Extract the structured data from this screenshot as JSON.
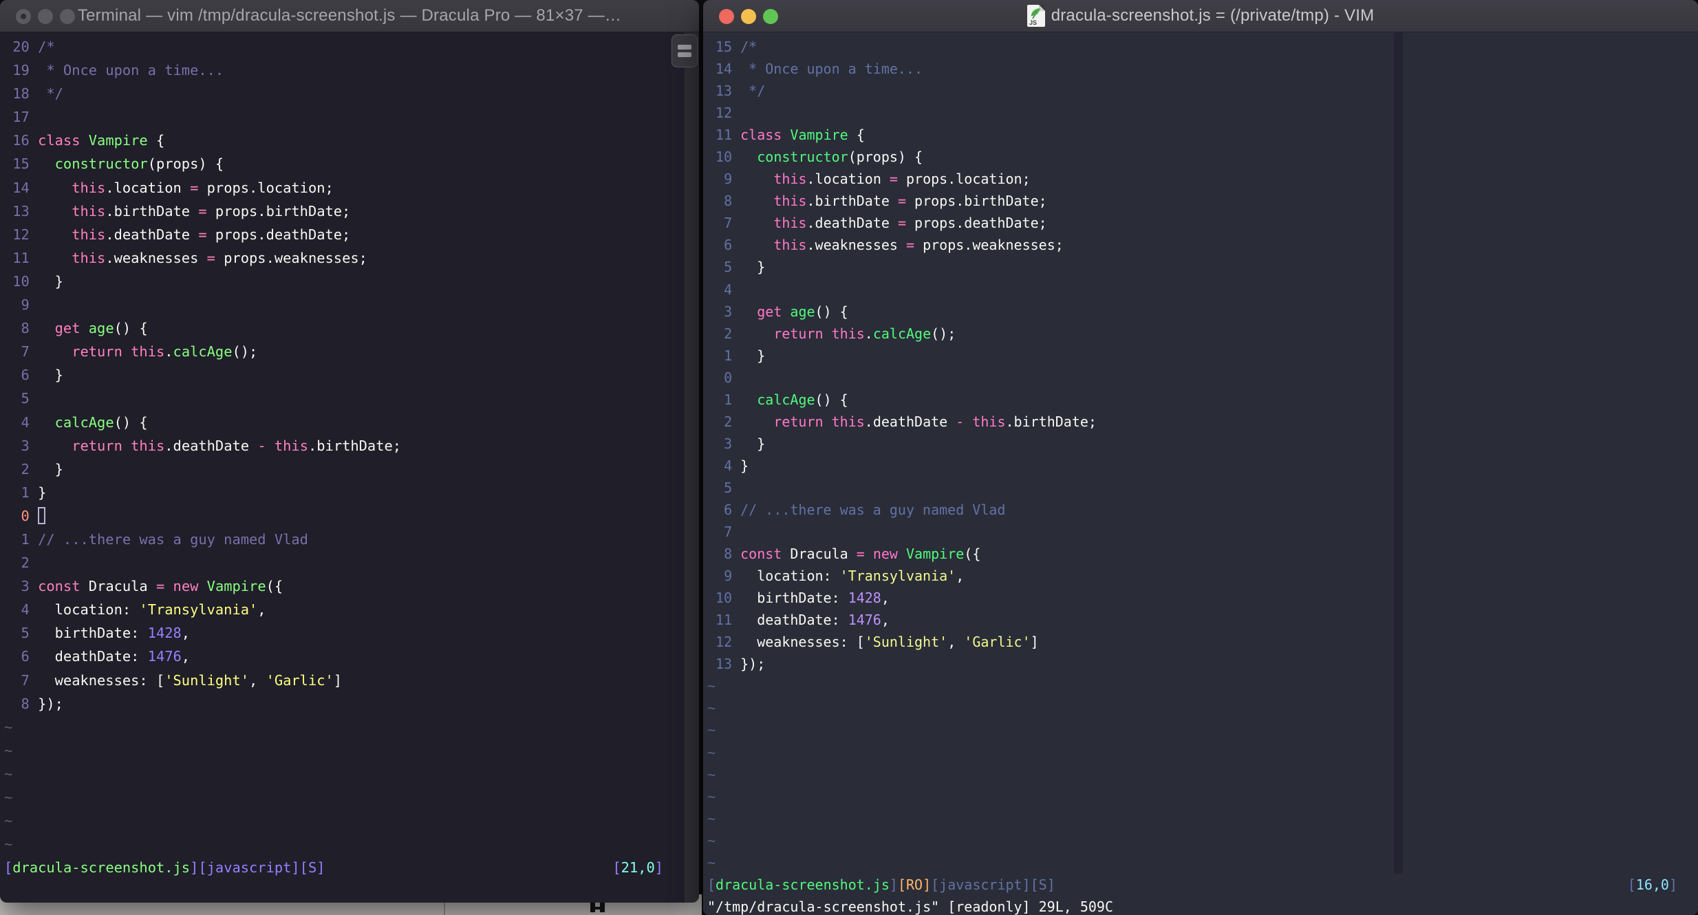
{
  "desktop": {
    "note_fragment": true
  },
  "left_window": {
    "titlebar": {
      "title": "Terminal — vim /tmp/dracula-screenshot.js — Dracula Pro — 81×37 —…"
    },
    "palette": {
      "bg": "#1F1E29",
      "f": "#F8F8F2",
      "c": "#7970A9",
      "p": "#FF80BF",
      "g": "#8AFF80",
      "y": "#FFFF80",
      "u": "#9580FF",
      "n": "#80FFEA",
      "o": "#FF9580",
      "ln": "#7970A9",
      "cursor_ln": "#FF9580",
      "tilde": "#5F5C6E",
      "cursor_outline": "#B9B3D8"
    },
    "tilde_char": "~",
    "tilde_count": 6,
    "lines": [
      {
        "num": "20",
        "tokens": [
          [
            "c",
            "/*"
          ]
        ]
      },
      {
        "num": "19",
        "tokens": [
          [
            "c",
            " * Once upon a time..."
          ]
        ]
      },
      {
        "num": "18",
        "tokens": [
          [
            "c",
            " */"
          ]
        ]
      },
      {
        "num": "17",
        "tokens": []
      },
      {
        "num": "16",
        "tokens": [
          [
            "p",
            "class"
          ],
          [
            "f",
            " "
          ],
          [
            "g",
            "Vampire"
          ],
          [
            "f",
            " {"
          ]
        ]
      },
      {
        "num": "15",
        "tokens": [
          [
            "f",
            "  "
          ],
          [
            "g",
            "constructor"
          ],
          [
            "f",
            "(props) {"
          ]
        ]
      },
      {
        "num": "14",
        "tokens": [
          [
            "f",
            "    "
          ],
          [
            "p",
            "this"
          ],
          [
            "f",
            ".location "
          ],
          [
            "p",
            "="
          ],
          [
            "f",
            " props.location;"
          ]
        ]
      },
      {
        "num": "13",
        "tokens": [
          [
            "f",
            "    "
          ],
          [
            "p",
            "this"
          ],
          [
            "f",
            ".birthDate "
          ],
          [
            "p",
            "="
          ],
          [
            "f",
            " props.birthDate;"
          ]
        ]
      },
      {
        "num": "12",
        "tokens": [
          [
            "f",
            "    "
          ],
          [
            "p",
            "this"
          ],
          [
            "f",
            ".deathDate "
          ],
          [
            "p",
            "="
          ],
          [
            "f",
            " props.deathDate;"
          ]
        ]
      },
      {
        "num": "11",
        "tokens": [
          [
            "f",
            "    "
          ],
          [
            "p",
            "this"
          ],
          [
            "f",
            ".weaknesses "
          ],
          [
            "p",
            "="
          ],
          [
            "f",
            " props.weaknesses;"
          ]
        ]
      },
      {
        "num": "10",
        "tokens": [
          [
            "f",
            "  }"
          ]
        ]
      },
      {
        "num": "9",
        "tokens": []
      },
      {
        "num": "8",
        "tokens": [
          [
            "f",
            "  "
          ],
          [
            "p",
            "get"
          ],
          [
            "f",
            " "
          ],
          [
            "g",
            "age"
          ],
          [
            "f",
            "() {"
          ]
        ]
      },
      {
        "num": "7",
        "tokens": [
          [
            "f",
            "    "
          ],
          [
            "p",
            "return"
          ],
          [
            "f",
            " "
          ],
          [
            "p",
            "this"
          ],
          [
            "f",
            "."
          ],
          [
            "g",
            "calcAge"
          ],
          [
            "f",
            "();"
          ]
        ]
      },
      {
        "num": "6",
        "tokens": [
          [
            "f",
            "  }"
          ]
        ]
      },
      {
        "num": "5",
        "tokens": []
      },
      {
        "num": "4",
        "tokens": [
          [
            "f",
            "  "
          ],
          [
            "g",
            "calcAge"
          ],
          [
            "f",
            "() {"
          ]
        ]
      },
      {
        "num": "3",
        "tokens": [
          [
            "f",
            "    "
          ],
          [
            "p",
            "return"
          ],
          [
            "f",
            " "
          ],
          [
            "p",
            "this"
          ],
          [
            "f",
            ".deathDate "
          ],
          [
            "p",
            "-"
          ],
          [
            "f",
            " "
          ],
          [
            "p",
            "this"
          ],
          [
            "f",
            ".birthDate;"
          ]
        ]
      },
      {
        "num": "2",
        "tokens": [
          [
            "f",
            "  }"
          ]
        ]
      },
      {
        "num": "1",
        "tokens": [
          [
            "f",
            "}"
          ]
        ]
      },
      {
        "num": "0",
        "tokens": [],
        "cursor": true,
        "cur_num": true
      },
      {
        "num": "1",
        "tokens": [
          [
            "c",
            "// ...there was a guy named Vlad"
          ]
        ]
      },
      {
        "num": "2",
        "tokens": []
      },
      {
        "num": "3",
        "tokens": [
          [
            "p",
            "const"
          ],
          [
            "f",
            " Dracula "
          ],
          [
            "p",
            "="
          ],
          [
            "f",
            " "
          ],
          [
            "p",
            "new"
          ],
          [
            "f",
            " "
          ],
          [
            "g",
            "Vampire"
          ],
          [
            "f",
            "({"
          ]
        ]
      },
      {
        "num": "4",
        "tokens": [
          [
            "f",
            "  location: "
          ],
          [
            "y",
            "'Transylvania'"
          ],
          [
            "f",
            ","
          ]
        ]
      },
      {
        "num": "5",
        "tokens": [
          [
            "f",
            "  birthDate: "
          ],
          [
            "u",
            "1428"
          ],
          [
            "f",
            ","
          ]
        ]
      },
      {
        "num": "6",
        "tokens": [
          [
            "f",
            "  deathDate: "
          ],
          [
            "u",
            "1476"
          ],
          [
            "f",
            ","
          ]
        ]
      },
      {
        "num": "7",
        "tokens": [
          [
            "f",
            "  weaknesses: ["
          ],
          [
            "y",
            "'Sunlight'"
          ],
          [
            "f",
            ", "
          ],
          [
            "y",
            "'Garlic'"
          ],
          [
            "f",
            "]"
          ]
        ]
      },
      {
        "num": "8",
        "tokens": [
          [
            "f",
            "});"
          ]
        ]
      }
    ],
    "status_left": [
      [
        "u",
        "["
      ],
      [
        "g",
        "dracula-screenshot.js"
      ],
      [
        "u",
        "][javascript][S]"
      ]
    ],
    "status_right": [
      [
        "u",
        "["
      ],
      [
        "n",
        "21,0"
      ],
      [
        "u",
        "]"
      ]
    ],
    "command_line": []
  },
  "right_window": {
    "titlebar": {
      "title": "dracula-screenshot.js = (/private/tmp) - VIM",
      "icon": "js-document-icon"
    },
    "palette": {
      "bg": "#2A2C38",
      "f": "#F8F8F2",
      "c": "#6272A4",
      "p": "#FF79C6",
      "g": "#50FA7B",
      "y": "#F1FA8C",
      "u": "#BD93F9",
      "n": "#8BE9FD",
      "o": "#FFB86C",
      "ln": "#6272A4",
      "cursor_ln": "#6272A4",
      "tilde": "#596180",
      "colorcolumn": "#242331"
    },
    "tilde_char": "~",
    "tilde_count": 9,
    "lines": [
      {
        "num": "15",
        "tokens": [
          [
            "c",
            "/*"
          ]
        ]
      },
      {
        "num": "14",
        "tokens": [
          [
            "c",
            " * Once upon a time..."
          ]
        ]
      },
      {
        "num": "13",
        "tokens": [
          [
            "c",
            " */"
          ]
        ]
      },
      {
        "num": "12",
        "tokens": []
      },
      {
        "num": "11",
        "tokens": [
          [
            "p",
            "class"
          ],
          [
            "f",
            " "
          ],
          [
            "g",
            "Vampire"
          ],
          [
            "f",
            " {"
          ]
        ]
      },
      {
        "num": "10",
        "tokens": [
          [
            "f",
            "  "
          ],
          [
            "g",
            "constructor"
          ],
          [
            "f",
            "(props) {"
          ]
        ]
      },
      {
        "num": "9",
        "tokens": [
          [
            "f",
            "    "
          ],
          [
            "p",
            "this"
          ],
          [
            "f",
            ".location "
          ],
          [
            "p",
            "="
          ],
          [
            "f",
            " props.location;"
          ]
        ]
      },
      {
        "num": "8",
        "tokens": [
          [
            "f",
            "    "
          ],
          [
            "p",
            "this"
          ],
          [
            "f",
            ".birthDate "
          ],
          [
            "p",
            "="
          ],
          [
            "f",
            " props.birthDate;"
          ]
        ]
      },
      {
        "num": "7",
        "tokens": [
          [
            "f",
            "    "
          ],
          [
            "p",
            "this"
          ],
          [
            "f",
            ".deathDate "
          ],
          [
            "p",
            "="
          ],
          [
            "f",
            " props.deathDate;"
          ]
        ]
      },
      {
        "num": "6",
        "tokens": [
          [
            "f",
            "    "
          ],
          [
            "p",
            "this"
          ],
          [
            "f",
            ".weaknesses "
          ],
          [
            "p",
            "="
          ],
          [
            "f",
            " props.weaknesses;"
          ]
        ]
      },
      {
        "num": "5",
        "tokens": [
          [
            "f",
            "  }"
          ]
        ]
      },
      {
        "num": "4",
        "tokens": []
      },
      {
        "num": "3",
        "tokens": [
          [
            "f",
            "  "
          ],
          [
            "p",
            "get"
          ],
          [
            "f",
            " "
          ],
          [
            "g",
            "age"
          ],
          [
            "f",
            "() {"
          ]
        ]
      },
      {
        "num": "2",
        "tokens": [
          [
            "f",
            "    "
          ],
          [
            "p",
            "return"
          ],
          [
            "f",
            " "
          ],
          [
            "p",
            "this"
          ],
          [
            "f",
            "."
          ],
          [
            "g",
            "calcAge"
          ],
          [
            "f",
            "();"
          ]
        ]
      },
      {
        "num": "1",
        "tokens": [
          [
            "f",
            "  }"
          ]
        ]
      },
      {
        "num": "0",
        "tokens": [],
        "cur_num": true
      },
      {
        "num": "1",
        "tokens": [
          [
            "f",
            "  "
          ],
          [
            "g",
            "calcAge"
          ],
          [
            "f",
            "() {"
          ]
        ]
      },
      {
        "num": "2",
        "tokens": [
          [
            "f",
            "    "
          ],
          [
            "p",
            "return"
          ],
          [
            "f",
            " "
          ],
          [
            "p",
            "this"
          ],
          [
            "f",
            ".deathDate "
          ],
          [
            "p",
            "-"
          ],
          [
            "f",
            " "
          ],
          [
            "p",
            "this"
          ],
          [
            "f",
            ".birthDate;"
          ]
        ]
      },
      {
        "num": "3",
        "tokens": [
          [
            "f",
            "  }"
          ]
        ]
      },
      {
        "num": "4",
        "tokens": [
          [
            "f",
            "}"
          ]
        ]
      },
      {
        "num": "5",
        "tokens": []
      },
      {
        "num": "6",
        "tokens": [
          [
            "c",
            "// ...there was a guy named Vlad"
          ]
        ]
      },
      {
        "num": "7",
        "tokens": []
      },
      {
        "num": "8",
        "tokens": [
          [
            "p",
            "const"
          ],
          [
            "f",
            " Dracula "
          ],
          [
            "p",
            "="
          ],
          [
            "f",
            " "
          ],
          [
            "p",
            "new"
          ],
          [
            "f",
            " "
          ],
          [
            "g",
            "Vampire"
          ],
          [
            "f",
            "({"
          ]
        ]
      },
      {
        "num": "9",
        "tokens": [
          [
            "f",
            "  location: "
          ],
          [
            "y",
            "'Transylvania'"
          ],
          [
            "f",
            ","
          ]
        ]
      },
      {
        "num": "10",
        "tokens": [
          [
            "f",
            "  birthDate: "
          ],
          [
            "u",
            "1428"
          ],
          [
            "f",
            ","
          ]
        ]
      },
      {
        "num": "11",
        "tokens": [
          [
            "f",
            "  deathDate: "
          ],
          [
            "u",
            "1476"
          ],
          [
            "f",
            ","
          ]
        ]
      },
      {
        "num": "12",
        "tokens": [
          [
            "f",
            "  weaknesses: ["
          ],
          [
            "y",
            "'Sunlight'"
          ],
          [
            "f",
            ", "
          ],
          [
            "y",
            "'Garlic'"
          ],
          [
            "f",
            "]"
          ]
        ]
      },
      {
        "num": "13",
        "tokens": [
          [
            "f",
            "});"
          ]
        ]
      }
    ],
    "status_left": [
      [
        "c",
        "["
      ],
      [
        "g",
        "dracula-screenshot.js"
      ],
      [
        "c",
        "]"
      ],
      [
        "o",
        "[RO]"
      ],
      [
        "c",
        "[javascript][S]"
      ]
    ],
    "status_right": [
      [
        "c",
        "["
      ],
      [
        "n",
        "16,0"
      ],
      [
        "c",
        "]"
      ]
    ],
    "command_line": [
      [
        "f",
        "\"/tmp/dracula-screenshot.js\" [readonly] 29L, 509C"
      ]
    ]
  }
}
